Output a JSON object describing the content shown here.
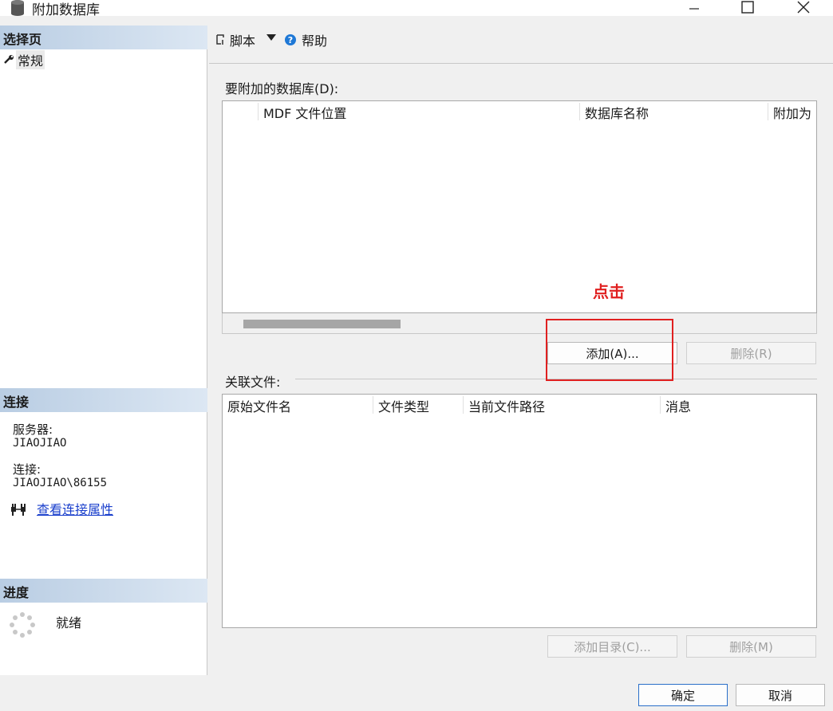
{
  "window": {
    "title": "附加数据库",
    "icon": "database-icon"
  },
  "left": {
    "select_page_header": "选择页",
    "nav_items": [
      {
        "label": "常规",
        "icon": "wrench-icon"
      }
    ],
    "connection_header": "连接",
    "server_label": "服务器:",
    "server_value": "JIAOJIAO",
    "connection_label": "连接:",
    "connection_value": "JIAOJIAO\\86155",
    "view_props_link": "查看连接属性",
    "progress_header": "进度",
    "progress_status": "就绪"
  },
  "toolbar": {
    "script_label": "脚本",
    "help_label": "帮助"
  },
  "databases": {
    "label": "要附加的数据库(D):",
    "columns": [
      "MDF 文件位置",
      "数据库名称",
      "附加为"
    ],
    "add_button": "添加(A)...",
    "remove_button": "删除(R)"
  },
  "related_files": {
    "label": "关联文件:",
    "columns": [
      "原始文件名",
      "文件类型",
      "当前文件路径",
      "消息"
    ],
    "add_catalog_button": "添加目录(C)...",
    "remove_button": "删除(M)"
  },
  "annotation": {
    "text": "点击",
    "color": "#e02020"
  },
  "footer": {
    "ok_button": "确定",
    "cancel_button": "取消"
  }
}
